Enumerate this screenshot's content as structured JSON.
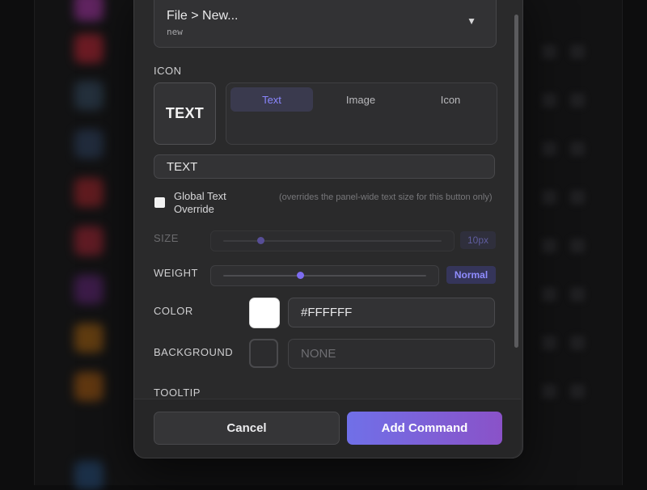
{
  "command_select": {
    "value": "File > New...",
    "sub": "new"
  },
  "icon_section": {
    "label": "ICON",
    "preview_text": "TEXT",
    "tabs": [
      {
        "label": "Text",
        "active": true
      },
      {
        "label": "Image",
        "active": false
      },
      {
        "label": "Icon",
        "active": false
      }
    ],
    "text_value": "TEXT"
  },
  "global_override": {
    "label": "Global Text Override",
    "hint": "(overrides the panel-wide text size for this button only)",
    "checked": false
  },
  "size": {
    "label": "SIZE",
    "value": "10px",
    "level": 0.17
  },
  "weight": {
    "label": "WEIGHT",
    "value": "Normal",
    "level": 0.38
  },
  "color": {
    "label": "COLOR",
    "value": "#FFFFFF"
  },
  "background": {
    "label": "BACKGROUND",
    "placeholder": "NONE"
  },
  "tooltip": {
    "label": "TOOLTIP"
  },
  "footer": {
    "cancel_label": "Cancel",
    "primary_label": "Add Command"
  },
  "colors": {
    "accent": "#7a6cf0",
    "primary_gradient_start": "#7070e8",
    "primary_gradient_end": "#8a52c8",
    "modal_bg": "#2a2a2b"
  }
}
